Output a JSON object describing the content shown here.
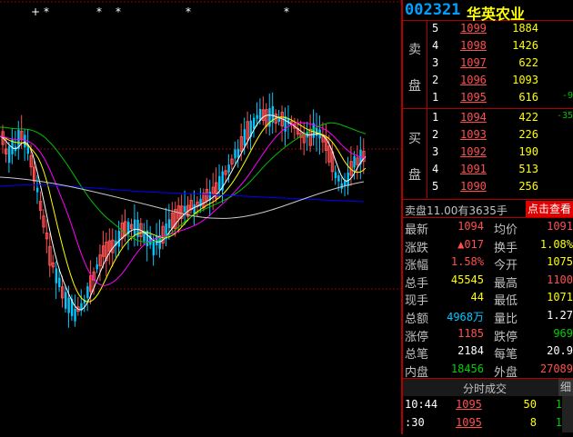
{
  "header": {
    "code": "002321",
    "name": "华英农业"
  },
  "asks": [
    {
      "level": "5",
      "price": "1099",
      "volume": "1884",
      "extra": ""
    },
    {
      "level": "4",
      "price": "1098",
      "volume": "1426",
      "extra": ""
    },
    {
      "level": "3",
      "price": "1097",
      "volume": "622",
      "extra": ""
    },
    {
      "level": "2",
      "price": "1096",
      "volume": "1093",
      "extra": ""
    },
    {
      "level": "1",
      "price": "1095",
      "volume": "616",
      "extra": "-9"
    }
  ],
  "bids": [
    {
      "level": "1",
      "price": "1094",
      "volume": "422",
      "extra": "-35"
    },
    {
      "level": "2",
      "price": "1093",
      "volume": "226",
      "extra": ""
    },
    {
      "level": "3",
      "price": "1092",
      "volume": "190",
      "extra": ""
    },
    {
      "level": "4",
      "price": "1091",
      "volume": "513",
      "extra": ""
    },
    {
      "level": "5",
      "price": "1090",
      "volume": "256",
      "extra": ""
    }
  ],
  "labels": {
    "sell_1": "卖",
    "sell_2": "盘",
    "buy_1": "买",
    "buy_2": "盘"
  },
  "weicha": {
    "text": "卖盘11.00有3635手",
    "button": "点击查看"
  },
  "stats": [
    {
      "k": "最新",
      "v": "1094",
      "vc": "red",
      "k2": "均价",
      "v2": "1091",
      "v2c": "red"
    },
    {
      "k": "涨跌",
      "v": "▲017",
      "vc": "red",
      "k2": "换手",
      "v2": "1.08%",
      "v2c": "yel"
    },
    {
      "k": "涨幅",
      "v": "1.58%",
      "vc": "red",
      "k2": "今开",
      "v2": "1075",
      "v2c": "yel"
    },
    {
      "k": "总手",
      "v": "45545",
      "vc": "yel",
      "k2": "最高",
      "v2": "1100",
      "v2c": "red"
    },
    {
      "k": "现手",
      "v": "44",
      "vc": "yel",
      "k2": "最低",
      "v2": "1071",
      "v2c": "yel"
    },
    {
      "k": "总额",
      "v": "4968万",
      "vc": "cyan",
      "k2": "量比",
      "v2": "1.27",
      "v2c": "wht"
    },
    {
      "k": "涨停",
      "v": "1185",
      "vc": "red",
      "k2": "跌停",
      "v2": "969",
      "v2c": "grn"
    },
    {
      "k": "总笔",
      "v": "2184",
      "vc": "wht",
      "k2": "每笔",
      "v2": "20.9",
      "v2c": "wht"
    },
    {
      "k": "内盘",
      "v": "18456",
      "vc": "grn",
      "k2": "外盘",
      "v2": "27089",
      "v2c": "red"
    }
  ],
  "ticks_header": {
    "title": "分时成交",
    "detail": "细"
  },
  "ticks": [
    {
      "time": "10:44",
      "price": "1095",
      "vol": "50",
      "n": "1"
    },
    {
      "time": ":30",
      "price": "1095",
      "vol": "8",
      "n": "1"
    }
  ],
  "chart_markers": [
    "+",
    "*",
    "*",
    "*",
    "*",
    "*"
  ],
  "colors": {
    "up": "#ff5050",
    "down": "#00c8ff",
    "ma5": "#ffffff",
    "ma10": "#ffff00",
    "ma20": "#ff00ff",
    "ma30": "#00c000",
    "ma60": "#0000ff",
    "grid": "#8b0000"
  }
}
